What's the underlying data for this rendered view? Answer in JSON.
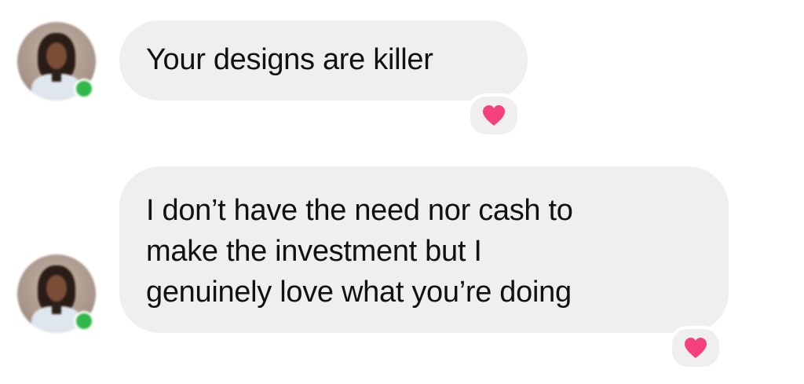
{
  "messages": [
    {
      "text": "Your designs are killer",
      "reaction": "heart-icon",
      "sender_online": true
    },
    {
      "lines": [
        "I don’t have the need nor cash to",
        "make the investment but I",
        "genuinely love what you’re doing"
      ],
      "reaction": "heart-icon",
      "sender_online": true
    }
  ],
  "colors": {
    "bubble": "#efefef",
    "online": "#31b84a",
    "heart": "#f4407d"
  }
}
